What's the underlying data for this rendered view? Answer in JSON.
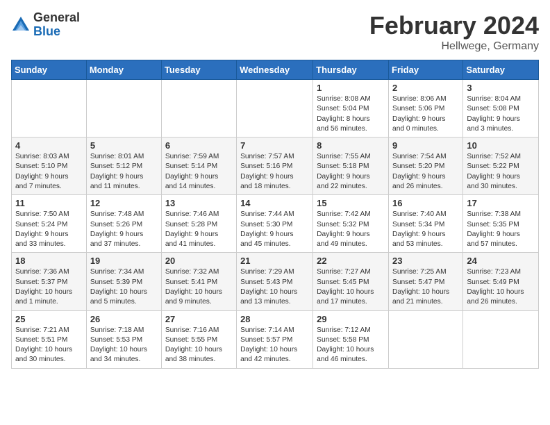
{
  "header": {
    "logo_general": "General",
    "logo_blue": "Blue",
    "month_title": "February 2024",
    "location": "Hellwege, Germany"
  },
  "weekdays": [
    "Sunday",
    "Monday",
    "Tuesday",
    "Wednesday",
    "Thursday",
    "Friday",
    "Saturday"
  ],
  "weeks": [
    [
      {
        "day": "",
        "info": ""
      },
      {
        "day": "",
        "info": ""
      },
      {
        "day": "",
        "info": ""
      },
      {
        "day": "",
        "info": ""
      },
      {
        "day": "1",
        "info": "Sunrise: 8:08 AM\nSunset: 5:04 PM\nDaylight: 8 hours\nand 56 minutes."
      },
      {
        "day": "2",
        "info": "Sunrise: 8:06 AM\nSunset: 5:06 PM\nDaylight: 9 hours\nand 0 minutes."
      },
      {
        "day": "3",
        "info": "Sunrise: 8:04 AM\nSunset: 5:08 PM\nDaylight: 9 hours\nand 3 minutes."
      }
    ],
    [
      {
        "day": "4",
        "info": "Sunrise: 8:03 AM\nSunset: 5:10 PM\nDaylight: 9 hours\nand 7 minutes."
      },
      {
        "day": "5",
        "info": "Sunrise: 8:01 AM\nSunset: 5:12 PM\nDaylight: 9 hours\nand 11 minutes."
      },
      {
        "day": "6",
        "info": "Sunrise: 7:59 AM\nSunset: 5:14 PM\nDaylight: 9 hours\nand 14 minutes."
      },
      {
        "day": "7",
        "info": "Sunrise: 7:57 AM\nSunset: 5:16 PM\nDaylight: 9 hours\nand 18 minutes."
      },
      {
        "day": "8",
        "info": "Sunrise: 7:55 AM\nSunset: 5:18 PM\nDaylight: 9 hours\nand 22 minutes."
      },
      {
        "day": "9",
        "info": "Sunrise: 7:54 AM\nSunset: 5:20 PM\nDaylight: 9 hours\nand 26 minutes."
      },
      {
        "day": "10",
        "info": "Sunrise: 7:52 AM\nSunset: 5:22 PM\nDaylight: 9 hours\nand 30 minutes."
      }
    ],
    [
      {
        "day": "11",
        "info": "Sunrise: 7:50 AM\nSunset: 5:24 PM\nDaylight: 9 hours\nand 33 minutes."
      },
      {
        "day": "12",
        "info": "Sunrise: 7:48 AM\nSunset: 5:26 PM\nDaylight: 9 hours\nand 37 minutes."
      },
      {
        "day": "13",
        "info": "Sunrise: 7:46 AM\nSunset: 5:28 PM\nDaylight: 9 hours\nand 41 minutes."
      },
      {
        "day": "14",
        "info": "Sunrise: 7:44 AM\nSunset: 5:30 PM\nDaylight: 9 hours\nand 45 minutes."
      },
      {
        "day": "15",
        "info": "Sunrise: 7:42 AM\nSunset: 5:32 PM\nDaylight: 9 hours\nand 49 minutes."
      },
      {
        "day": "16",
        "info": "Sunrise: 7:40 AM\nSunset: 5:34 PM\nDaylight: 9 hours\nand 53 minutes."
      },
      {
        "day": "17",
        "info": "Sunrise: 7:38 AM\nSunset: 5:35 PM\nDaylight: 9 hours\nand 57 minutes."
      }
    ],
    [
      {
        "day": "18",
        "info": "Sunrise: 7:36 AM\nSunset: 5:37 PM\nDaylight: 10 hours\nand 1 minute."
      },
      {
        "day": "19",
        "info": "Sunrise: 7:34 AM\nSunset: 5:39 PM\nDaylight: 10 hours\nand 5 minutes."
      },
      {
        "day": "20",
        "info": "Sunrise: 7:32 AM\nSunset: 5:41 PM\nDaylight: 10 hours\nand 9 minutes."
      },
      {
        "day": "21",
        "info": "Sunrise: 7:29 AM\nSunset: 5:43 PM\nDaylight: 10 hours\nand 13 minutes."
      },
      {
        "day": "22",
        "info": "Sunrise: 7:27 AM\nSunset: 5:45 PM\nDaylight: 10 hours\nand 17 minutes."
      },
      {
        "day": "23",
        "info": "Sunrise: 7:25 AM\nSunset: 5:47 PM\nDaylight: 10 hours\nand 21 minutes."
      },
      {
        "day": "24",
        "info": "Sunrise: 7:23 AM\nSunset: 5:49 PM\nDaylight: 10 hours\nand 26 minutes."
      }
    ],
    [
      {
        "day": "25",
        "info": "Sunrise: 7:21 AM\nSunset: 5:51 PM\nDaylight: 10 hours\nand 30 minutes."
      },
      {
        "day": "26",
        "info": "Sunrise: 7:18 AM\nSunset: 5:53 PM\nDaylight: 10 hours\nand 34 minutes."
      },
      {
        "day": "27",
        "info": "Sunrise: 7:16 AM\nSunset: 5:55 PM\nDaylight: 10 hours\nand 38 minutes."
      },
      {
        "day": "28",
        "info": "Sunrise: 7:14 AM\nSunset: 5:57 PM\nDaylight: 10 hours\nand 42 minutes."
      },
      {
        "day": "29",
        "info": "Sunrise: 7:12 AM\nSunset: 5:58 PM\nDaylight: 10 hours\nand 46 minutes."
      },
      {
        "day": "",
        "info": ""
      },
      {
        "day": "",
        "info": ""
      }
    ]
  ]
}
